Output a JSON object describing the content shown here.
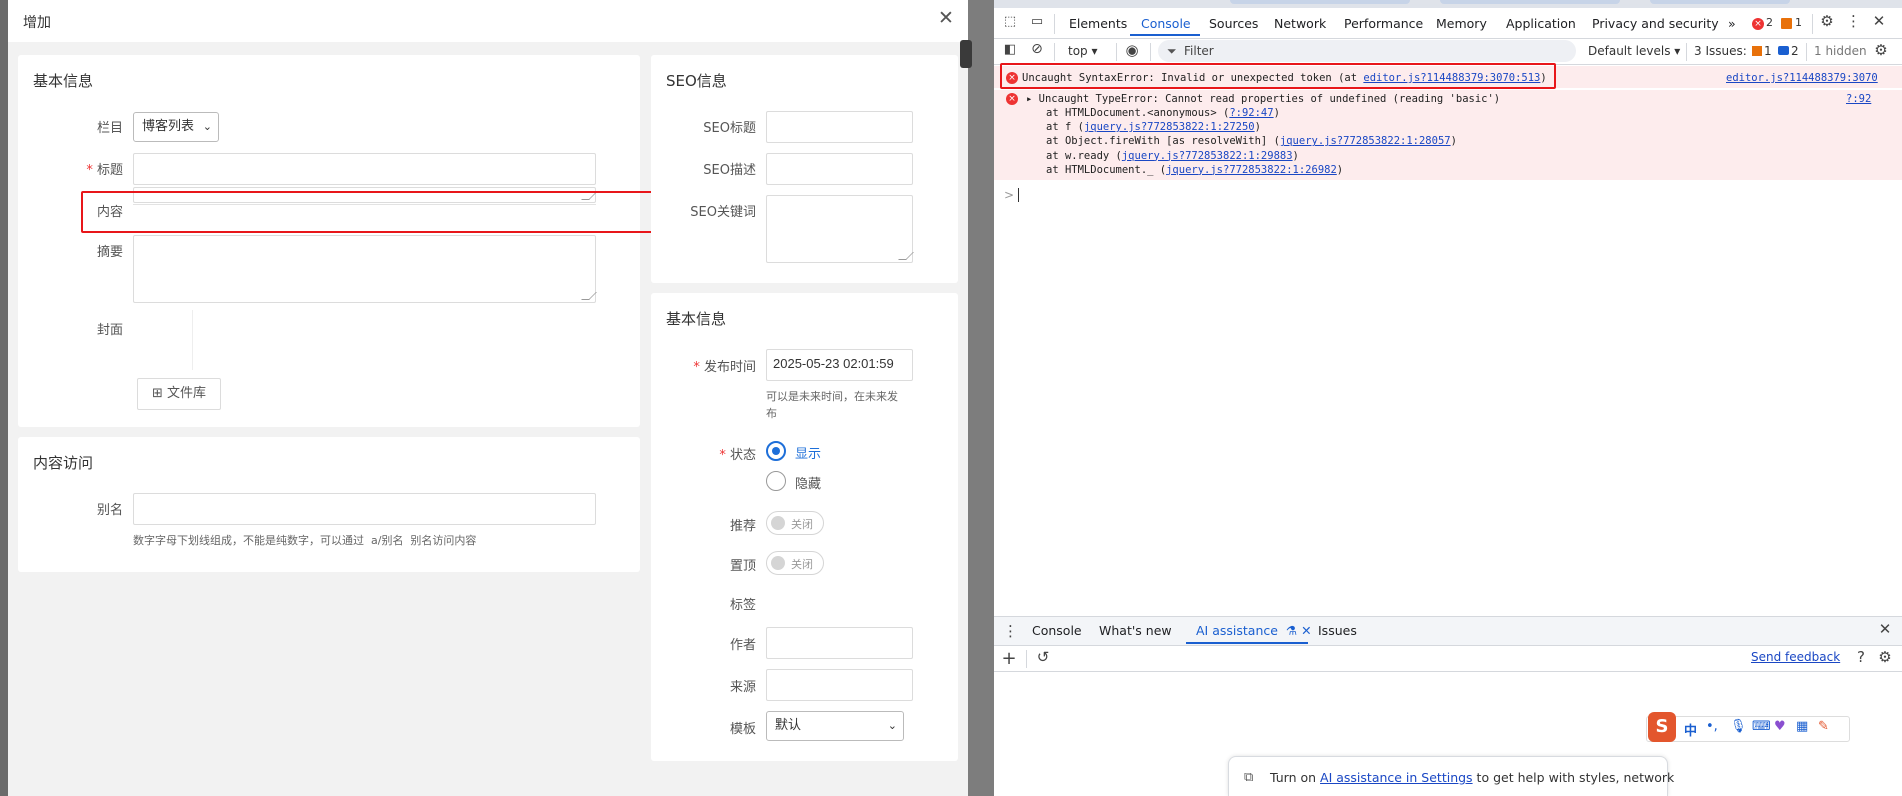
{
  "dialog": {
    "title": "增加",
    "basic_card": {
      "title": "基本信息",
      "column_label": "栏目",
      "column_value": "博客列表",
      "title_label": "标题",
      "content_label": "内容",
      "summary_label": "摘要",
      "cover_label": "封面",
      "library_button": "文件库",
      "required_mark": "*"
    },
    "access_card": {
      "title": "内容访问",
      "alias_label": "别名",
      "alias_hint": "数字字母下划线组成，不能是纯数字，可以通过  a/别名  别名访问内容"
    },
    "seo_card": {
      "title": "SEO信息",
      "seo_title_label": "SEO标题",
      "seo_desc_label": "SEO描述",
      "seo_keywords_label": "SEO关键词"
    },
    "basic_right_card": {
      "title": "基本信息",
      "publish_label": "发布时间",
      "publish_value": "2025-05-23 02:01:59",
      "publish_hint_1": "可以是未来时间，在未来发",
      "publish_hint_2": "布",
      "status_label": "状态",
      "status_show": "显示",
      "status_hide": "隐藏",
      "recommend_label": "推荐",
      "recommend_value": "关闭",
      "top_label": "置顶",
      "top_value": "关闭",
      "tags_label": "标签",
      "author_label": "作者",
      "source_label": "来源",
      "template_label": "模板",
      "template_value": "默认",
      "required_mark": "*"
    }
  },
  "devtools": {
    "tabs": [
      "Elements",
      "Console",
      "Sources",
      "Network",
      "Performance",
      "Memory",
      "Application",
      "Privacy and security"
    ],
    "active_tab": "Console",
    "more_tabs": "»",
    "error_count": "2",
    "warn_count": "1",
    "context": "top",
    "filter_placeholder": "Filter",
    "levels": "Default levels",
    "issues_label": "3 Issues:",
    "issues_warn": "1",
    "issues_info": "2",
    "hidden": "1 hidden",
    "errors": [
      {
        "text": "Uncaught SyntaxError: Invalid or unexpected token (at ",
        "link": "editor.js?114488379:3070:513",
        "tail": ")",
        "source": "editor.js?114488379:3070"
      },
      {
        "text": "Uncaught TypeError: Cannot read properties of undefined (reading 'basic')",
        "source": "?:92"
      }
    ],
    "stack": [
      {
        "pre": "at HTMLDocument.<anonymous> (",
        "link": "?:92:47",
        "post": ")"
      },
      {
        "pre": "at f (",
        "link": "jquery.js?772853822:1:27250",
        "post": ")"
      },
      {
        "pre": "at Object.fireWith [as resolveWith] (",
        "link": "jquery.js?772853822:1:28057",
        "post": ")"
      },
      {
        "pre": "at w.ready (",
        "link": "jquery.js?772853822:1:29883",
        "post": ")"
      },
      {
        "pre": "at HTMLDocument._ (",
        "link": "jquery.js?772853822:1:26982",
        "post": ")"
      }
    ],
    "prompt": ">",
    "drawer": {
      "tabs": [
        "Console",
        "What's new",
        "AI assistance",
        "Issues"
      ],
      "active_tab": "AI assistance",
      "send_feedback": "Send feedback",
      "banner_pre": "Turn on ",
      "banner_link": "AI assistance in Settings",
      "banner_post": " to get help with styles, network"
    },
    "ime": {
      "lang": "中"
    }
  }
}
